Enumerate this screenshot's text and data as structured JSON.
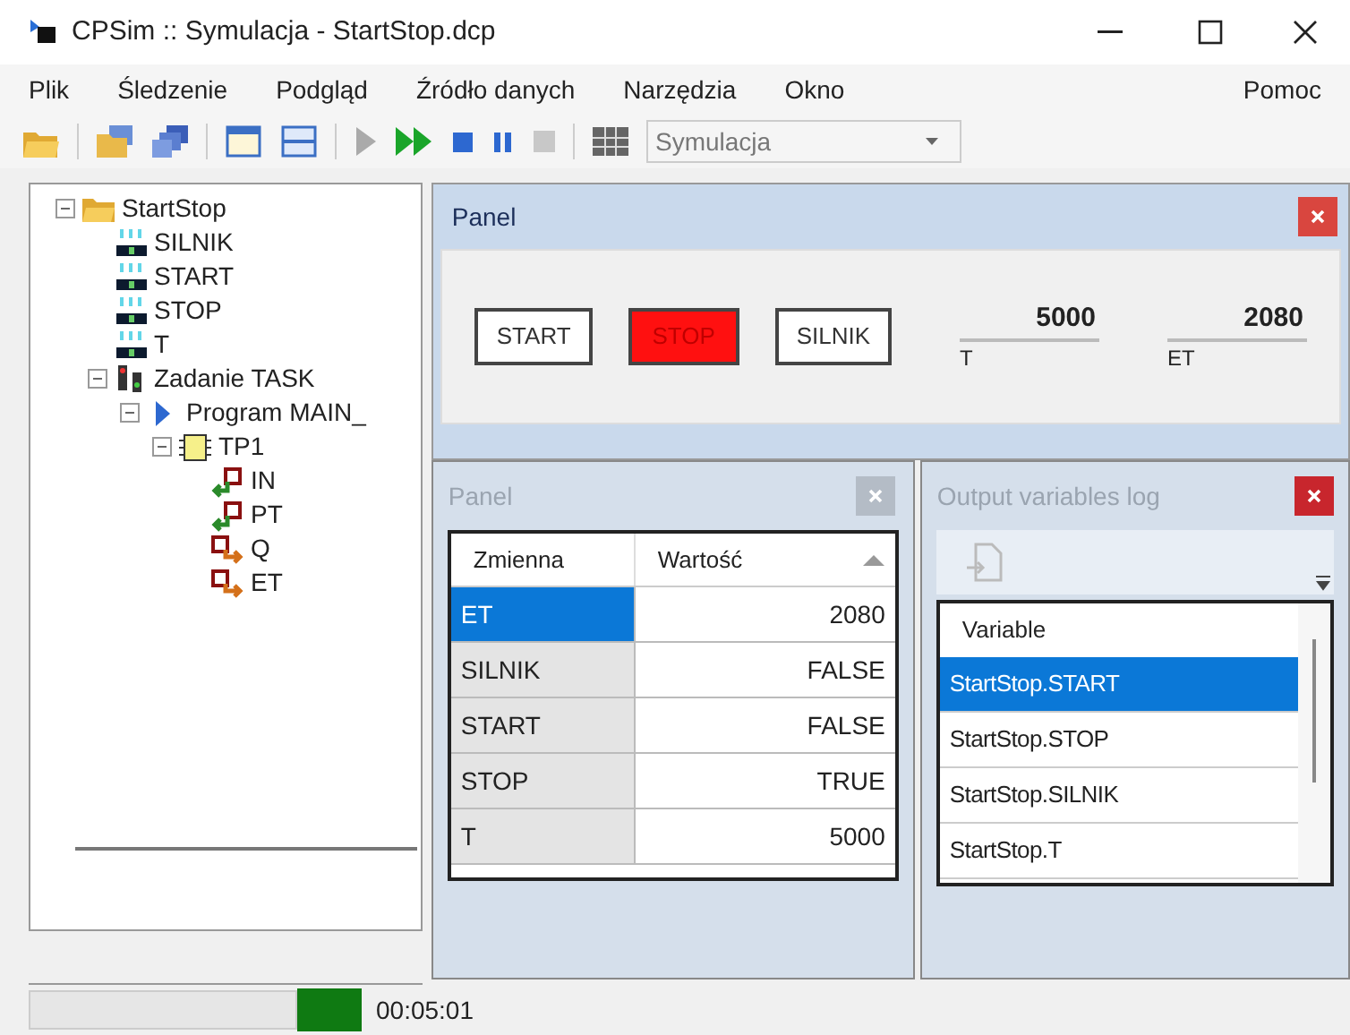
{
  "window": {
    "title": "CPSim :: Symulacja - StartStop.dcp"
  },
  "menu": [
    "Plik",
    "Śledzenie",
    "Podgląd",
    "Źródło danych",
    "Narzędzia",
    "Okno",
    "Pomoc"
  ],
  "toolbar": {
    "mode": "Symulacja"
  },
  "tree": [
    {
      "label": "StartStop",
      "kind": "folder",
      "expanded": true,
      "children": [
        {
          "label": "SILNIK",
          "kind": "variable"
        },
        {
          "label": "START",
          "kind": "variable"
        },
        {
          "label": "STOP",
          "kind": "variable"
        },
        {
          "label": "T",
          "kind": "variable"
        },
        {
          "label": "Zadanie TASK",
          "kind": "task",
          "expanded": true,
          "children": [
            {
              "label": "Program MAIN_",
              "kind": "program",
              "expanded": true,
              "children": [
                {
                  "label": "TP1",
                  "kind": "block",
                  "expanded": true,
                  "children": [
                    {
                      "label": "IN",
                      "kind": "input"
                    },
                    {
                      "label": "PT",
                      "kind": "input"
                    },
                    {
                      "label": "Q",
                      "kind": "output"
                    },
                    {
                      "label": "ET",
                      "kind": "output"
                    }
                  ]
                }
              ]
            }
          ]
        }
      ]
    }
  ],
  "panel": {
    "title": "Panel",
    "controls": [
      {
        "kind": "button",
        "label": "START",
        "on": false
      },
      {
        "kind": "button",
        "label": "STOP",
        "on": true
      },
      {
        "kind": "button",
        "label": "SILNIK",
        "on": false
      },
      {
        "kind": "display",
        "value": "5000",
        "label": "T"
      },
      {
        "kind": "display",
        "value": "2080",
        "label": "ET"
      }
    ]
  },
  "watch": {
    "title": "Panel",
    "columns": [
      "Zmienna",
      "Wartość"
    ],
    "rows": [
      {
        "name": "ET",
        "value": "2080",
        "selected": true
      },
      {
        "name": "SILNIK",
        "value": "FALSE",
        "selected": false
      },
      {
        "name": "START",
        "value": "FALSE",
        "selected": false
      },
      {
        "name": "STOP",
        "value": "TRUE",
        "selected": false
      },
      {
        "name": "T",
        "value": "5000",
        "selected": false
      }
    ]
  },
  "log": {
    "title": "Output variables log",
    "column": "Variable",
    "rows": [
      {
        "label": "StartStop.START",
        "selected": true
      },
      {
        "label": "StartStop.STOP",
        "selected": false
      },
      {
        "label": "StartStop.SILNIK",
        "selected": false
      },
      {
        "label": "StartStop.T",
        "selected": false
      }
    ]
  },
  "status_bar": {
    "time": "00:05:01"
  }
}
